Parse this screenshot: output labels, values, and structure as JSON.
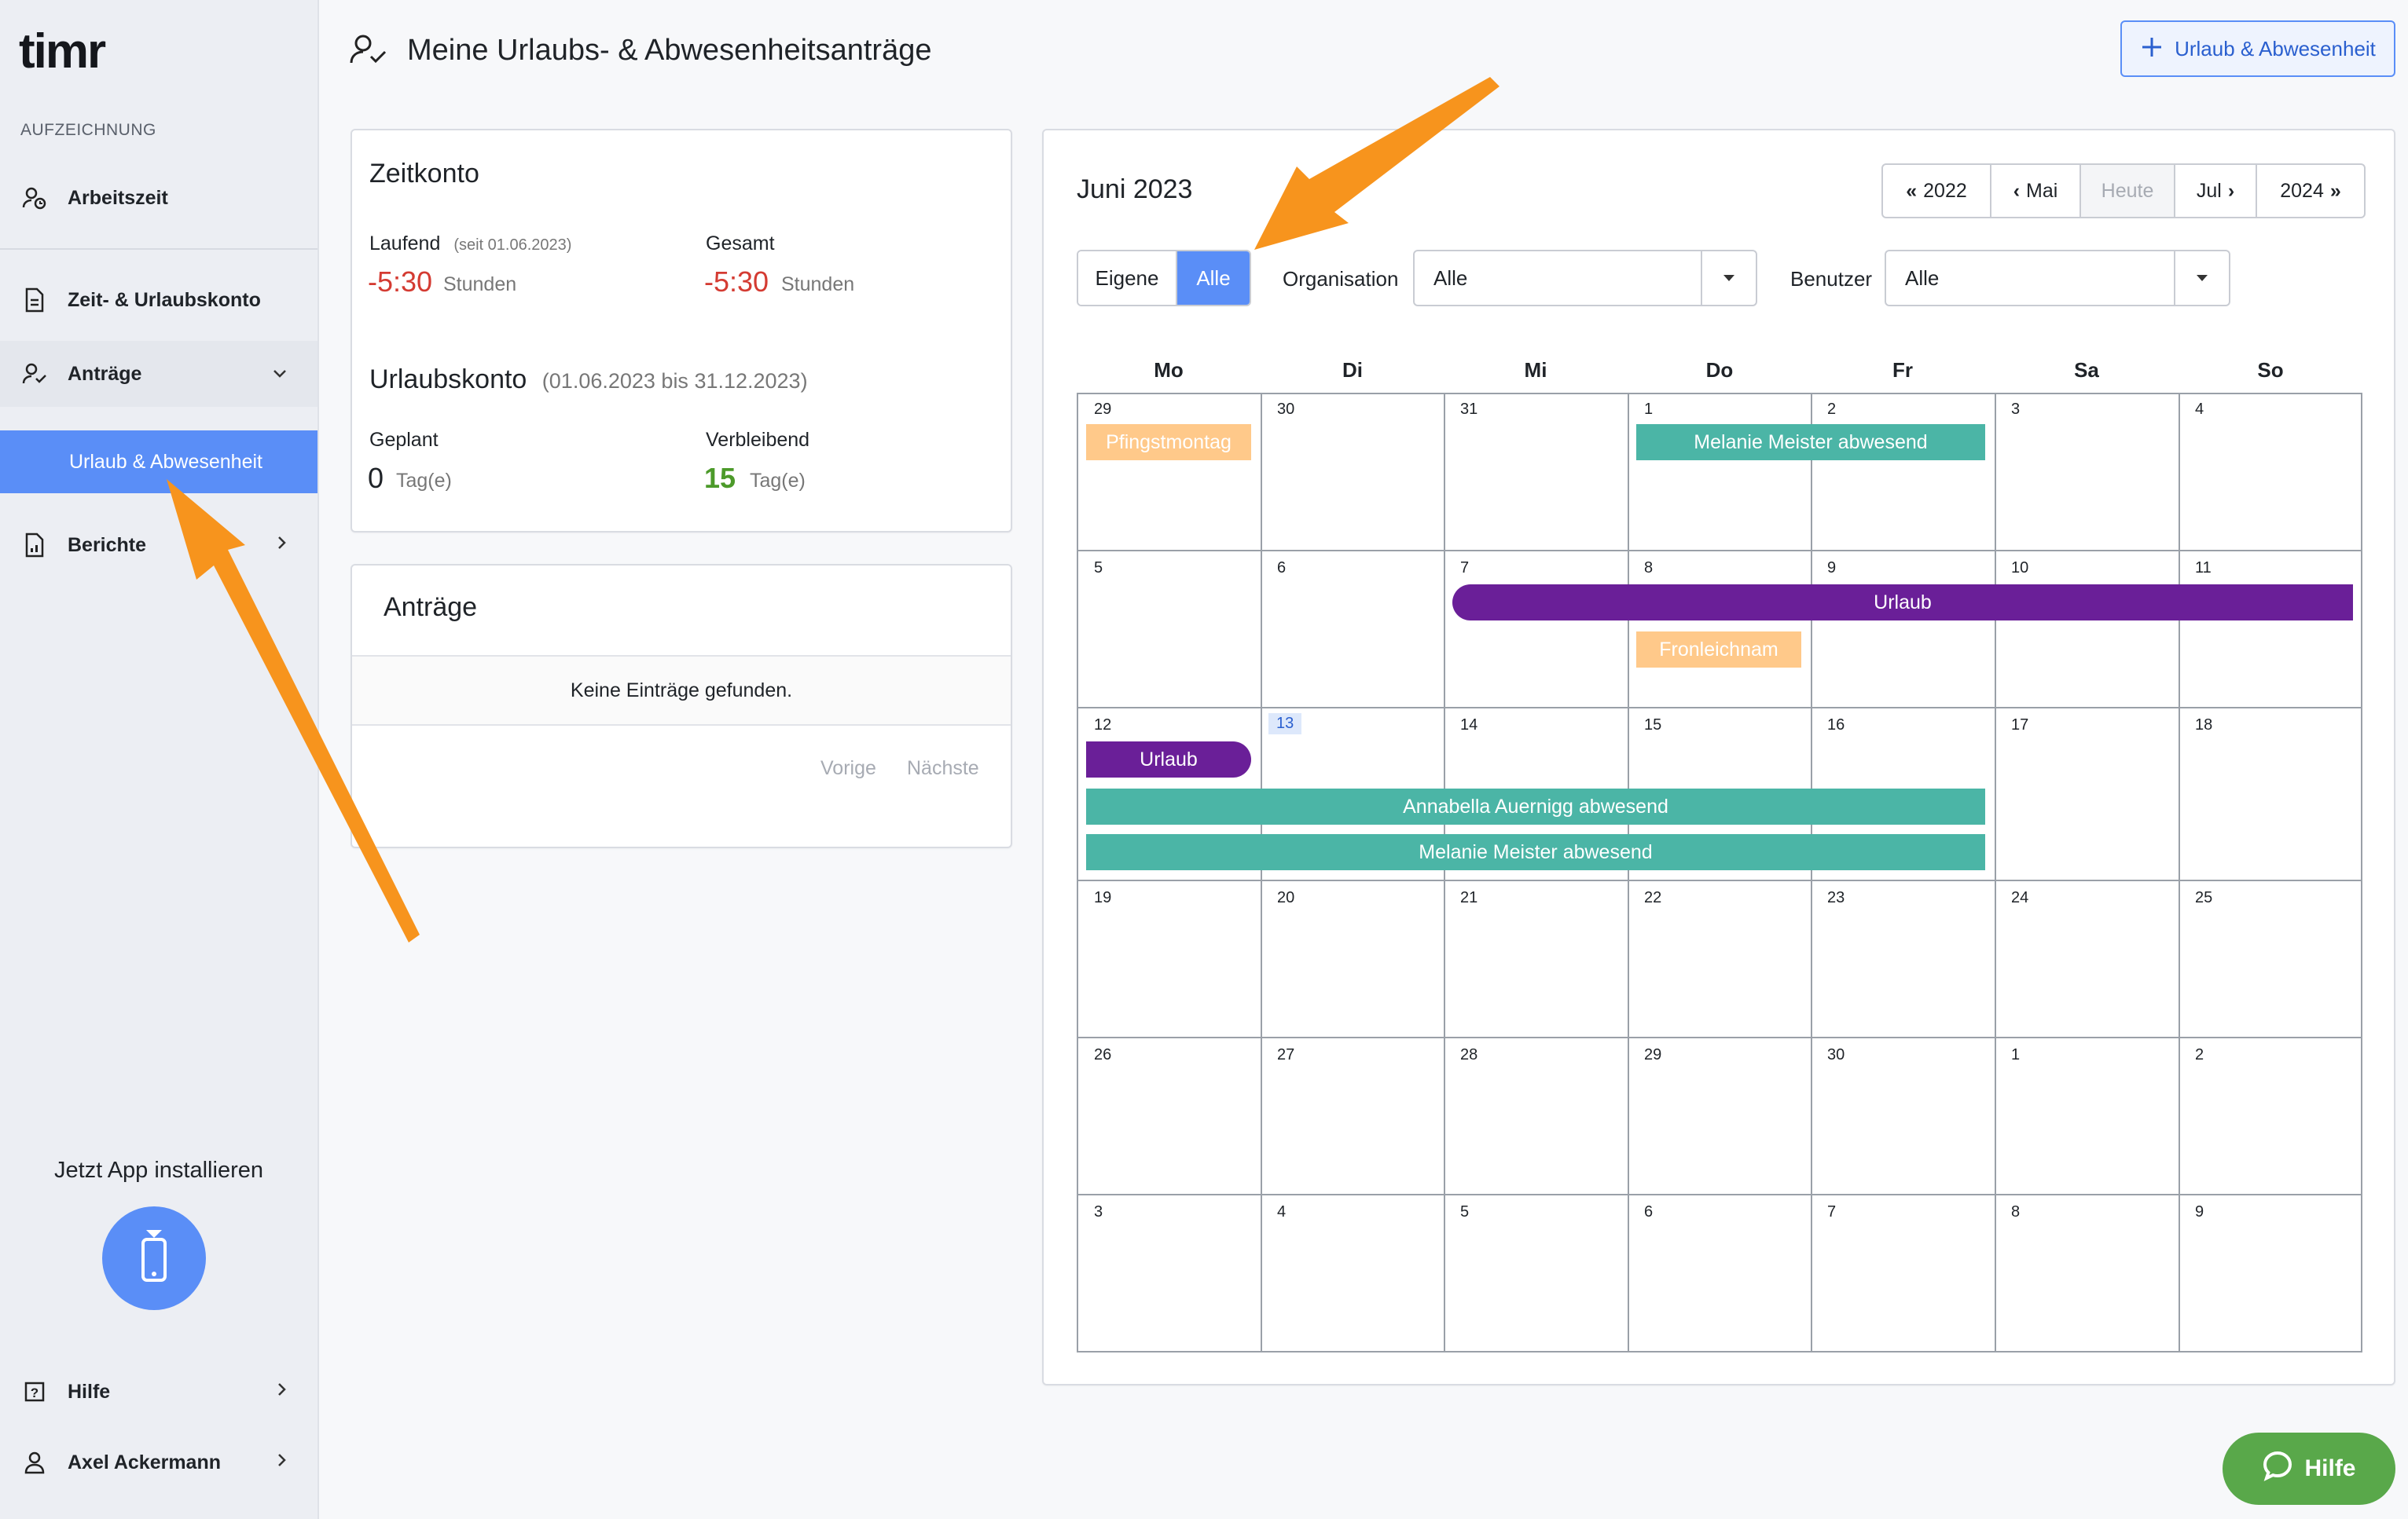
{
  "app": {
    "logo": "timr"
  },
  "sidebar": {
    "section_label": "AUFZEICHNUNG",
    "items": [
      {
        "label": "Arbeitszeit",
        "icon": "user-clock-icon"
      },
      {
        "label": "Zeit- & Urlaubskonto",
        "icon": "document-icon"
      },
      {
        "label": "Anträge",
        "icon": "user-check-icon"
      },
      {
        "label": "Urlaub & Abwesenheit"
      },
      {
        "label": "Berichte",
        "icon": "report-icon"
      }
    ],
    "install_label": "Jetzt App installieren",
    "help": "Hilfe",
    "user": "Axel Ackermann"
  },
  "header": {
    "title": "Meine Urlaubs- & Abwesenheitsanträge",
    "add_button": "Urlaub & Abwesenheit"
  },
  "zeitkonto": {
    "title": "Zeitkonto",
    "laufend_label": "Laufend",
    "laufend_sub": "(seit 01.06.2023)",
    "laufend_value": "-5:30",
    "gesamt_label": "Gesamt",
    "gesamt_value": "-5:30",
    "unit": "Stunden",
    "urlaub_title": "Urlaubskonto",
    "urlaub_range": "(01.06.2023 bis 31.12.2023)",
    "geplant_label": "Geplant",
    "geplant_value": "0",
    "verbleibend_label": "Verbleibend",
    "verbleibend_value": "15",
    "day_unit": "Tag(e)"
  },
  "antraege": {
    "title": "Anträge",
    "empty": "Keine Einträge gefunden.",
    "prev": "Vorige",
    "next": "Nächste"
  },
  "calendar": {
    "month": "Juni 2023",
    "nav": [
      "2022",
      "Mai",
      "Heute",
      "Jul",
      "2024"
    ],
    "toggle": [
      "Eigene",
      "Alle"
    ],
    "org_label": "Organisation",
    "org_value": "Alle",
    "user_label": "Benutzer",
    "user_value": "Alle",
    "weekdays": [
      "Mo",
      "Di",
      "Mi",
      "Do",
      "Fr",
      "Sa",
      "So"
    ],
    "weeks": [
      [
        "29",
        "30",
        "31",
        "1",
        "2",
        "3",
        "4"
      ],
      [
        "5",
        "6",
        "7",
        "8",
        "9",
        "10",
        "11"
      ],
      [
        "12",
        "13",
        "14",
        "15",
        "16",
        "17",
        "18"
      ],
      [
        "19",
        "20",
        "21",
        "22",
        "23",
        "24",
        "25"
      ],
      [
        "26",
        "27",
        "28",
        "29",
        "30",
        "1",
        "2"
      ],
      [
        "3",
        "4",
        "5",
        "6",
        "7",
        "8",
        "9"
      ]
    ],
    "today": "13",
    "events": {
      "pfingstmontag": "Pfingstmontag",
      "melanie1": "Melanie Meister abwesend",
      "urlaub1": "Urlaub",
      "fronleichnam": "Fronleichnam",
      "urlaub2": "Urlaub",
      "annabella": "Annabella Auernigg abwesend",
      "melanie2": "Melanie Meister abwesend"
    },
    "colors": {
      "teal": "#4bb5a6",
      "purple": "#6a1f98",
      "holiday": "#ffc98a",
      "accent": "#5a8ef7"
    }
  },
  "help_button": "Hilfe"
}
